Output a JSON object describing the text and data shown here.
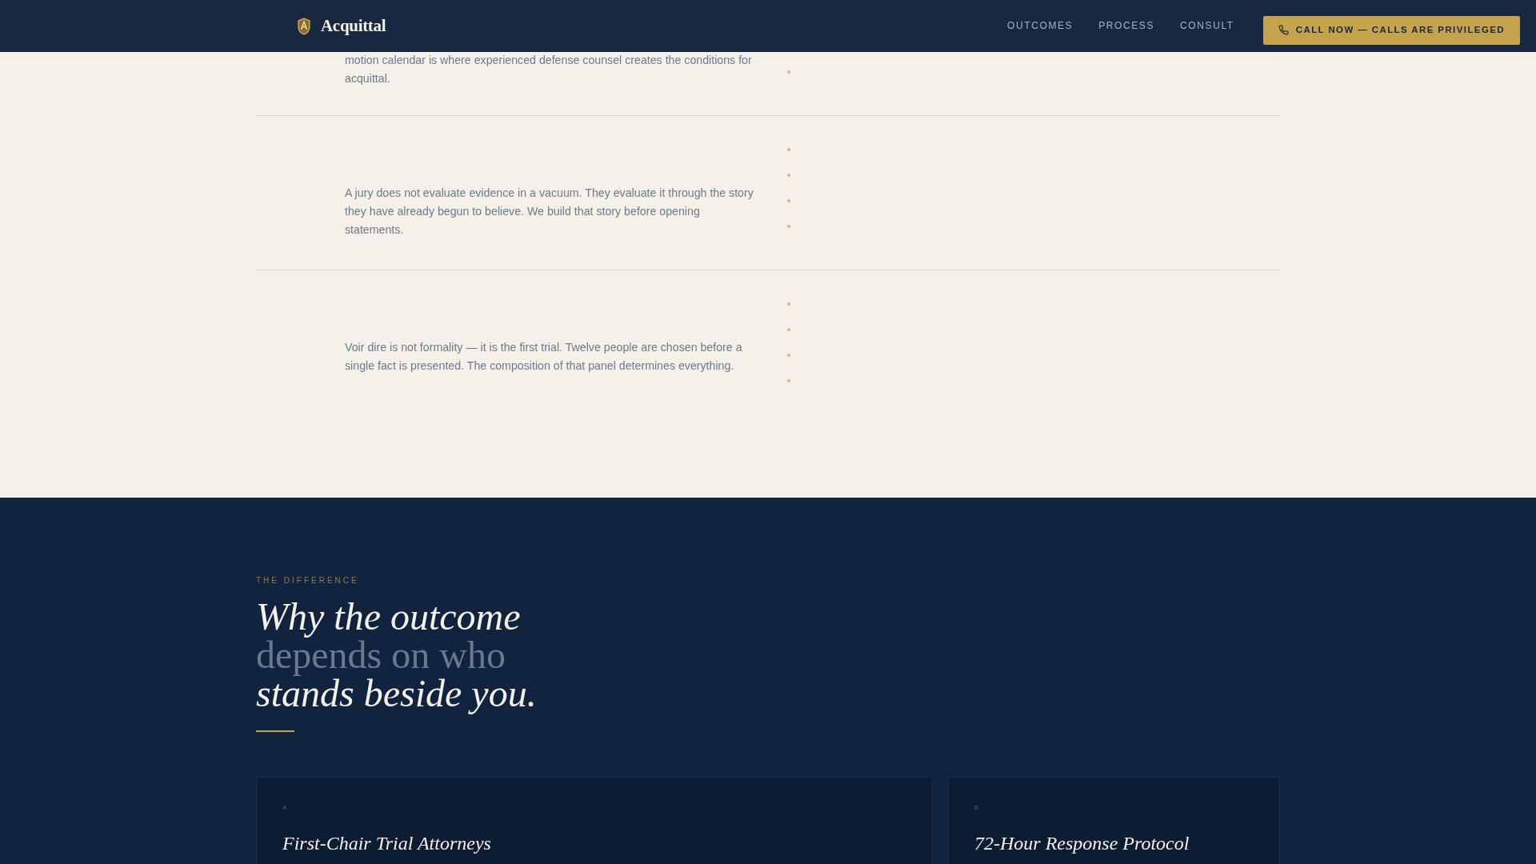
{
  "header": {
    "brand": "Acquittal",
    "nav": [
      {
        "label": "OUTCOMES"
      },
      {
        "label": "PROCESS"
      },
      {
        "label": "CONSULT"
      }
    ],
    "cta": "CALL NOW — CALLS ARE PRIVILEGED"
  },
  "process_rows": [
    {
      "text": "motion calendar is where experienced defense counsel creates the conditions for acquittal."
    },
    {
      "text": "A jury does not evaluate evidence in a vacuum. They evaluate it through the story they have already begun to believe. We build that story before opening statements."
    },
    {
      "text": "Voir dire is not formality — it is the first trial. Twelve people are chosen before a single fact is presented. The composition of that panel determines everything."
    }
  ],
  "difference": {
    "eyebrow": "THE DIFFERENCE",
    "heading": [
      {
        "text": "Why the outcome",
        "kind": "italic"
      },
      {
        "text": "depends on who",
        "kind": "muted"
      },
      {
        "text": "stands beside you.",
        "kind": "italic"
      }
    ],
    "cards": [
      {
        "letter": "A",
        "title": "First-Chair Trial Attorneys"
      },
      {
        "letter": "B",
        "title": "72-Hour Response Protocol"
      }
    ]
  }
}
